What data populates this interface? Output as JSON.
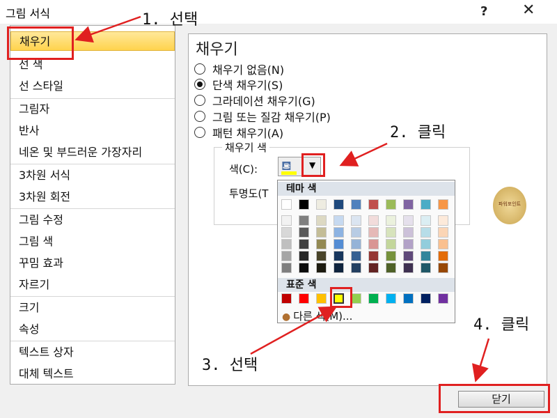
{
  "window": {
    "title": "그림 서식",
    "help_label": "?",
    "close_label": "✕"
  },
  "sidebar": {
    "items": [
      {
        "label": "채우기"
      },
      {
        "label": "선 색"
      },
      {
        "label": "선 스타일"
      },
      {
        "label": "그림자"
      },
      {
        "label": "반사"
      },
      {
        "label": "네온 및 부드러운 가장자리"
      },
      {
        "label": "3차원 서식"
      },
      {
        "label": "3차원 회전"
      },
      {
        "label": "그림 수정"
      },
      {
        "label": "그림 색"
      },
      {
        "label": "꾸밈 효과"
      },
      {
        "label": "자르기"
      },
      {
        "label": "크기"
      },
      {
        "label": "속성"
      },
      {
        "label": "텍스트 상자"
      },
      {
        "label": "대체 텍스트"
      }
    ]
  },
  "fill": {
    "title": "채우기",
    "options": [
      {
        "label": "채우기 없음(N)",
        "selected": false
      },
      {
        "label": "단색 채우기(S)",
        "selected": true
      },
      {
        "label": "그라데이션 채우기(G)",
        "selected": false
      },
      {
        "label": "그림 또는 질감 채우기(P)",
        "selected": false
      },
      {
        "label": "패턴 채우기(A)",
        "selected": false
      }
    ],
    "color_group_label": "채우기 색",
    "color_label": "색(C):",
    "transparency_label": "투명도(T"
  },
  "palette": {
    "theme_header": "테마 색",
    "standard_header": "표준 색",
    "more_colors": "다른 색(M)...",
    "theme_top": [
      "#ffffff",
      "#000000",
      "#eeece1",
      "#1f497d",
      "#4f81bd",
      "#c0504d",
      "#9bbb59",
      "#8064a2",
      "#4bacc6",
      "#f79646"
    ],
    "theme_shades": [
      [
        "#f2f2f2",
        "#7f7f7f",
        "#ddd9c3",
        "#c6d9f0",
        "#dbe5f1",
        "#f2dcdb",
        "#ebf1dd",
        "#e5e0ec",
        "#dbeef3",
        "#fdeada"
      ],
      [
        "#d8d8d8",
        "#595959",
        "#c4bd97",
        "#8db3e2",
        "#b8cce4",
        "#e5b9b7",
        "#d7e3bc",
        "#ccc1d9",
        "#b7dde8",
        "#fbd5b5"
      ],
      [
        "#bfbfbf",
        "#3f3f3f",
        "#938953",
        "#548dd4",
        "#95b3d7",
        "#d99694",
        "#c3d69b",
        "#b2a2c7",
        "#92cddc",
        "#fac08f"
      ],
      [
        "#a5a5a5",
        "#262626",
        "#494429",
        "#17365d",
        "#366092",
        "#953734",
        "#76923c",
        "#5f497a",
        "#31859b",
        "#e36c09"
      ],
      [
        "#7f7f7f",
        "#0c0c0c",
        "#1d1b10",
        "#0f243e",
        "#244061",
        "#632423",
        "#4f6128",
        "#3f3151",
        "#205867",
        "#974806"
      ]
    ],
    "standard": [
      "#c00000",
      "#ff0000",
      "#ffc000",
      "#ffff00",
      "#92d050",
      "#00b050",
      "#00b0f0",
      "#0070c0",
      "#002060",
      "#7030a0"
    ],
    "selected_standard_index": 3
  },
  "avatar_text": "파워포인트",
  "footer": {
    "close_button": "닫기"
  },
  "annotations": [
    {
      "text": "1. 선택"
    },
    {
      "text": "2. 클릭"
    },
    {
      "text": "3. 선택"
    },
    {
      "text": "4. 클릭"
    }
  ],
  "colors": {
    "annotation_red": "#e02020",
    "selection_gold": "#ffd34d"
  }
}
